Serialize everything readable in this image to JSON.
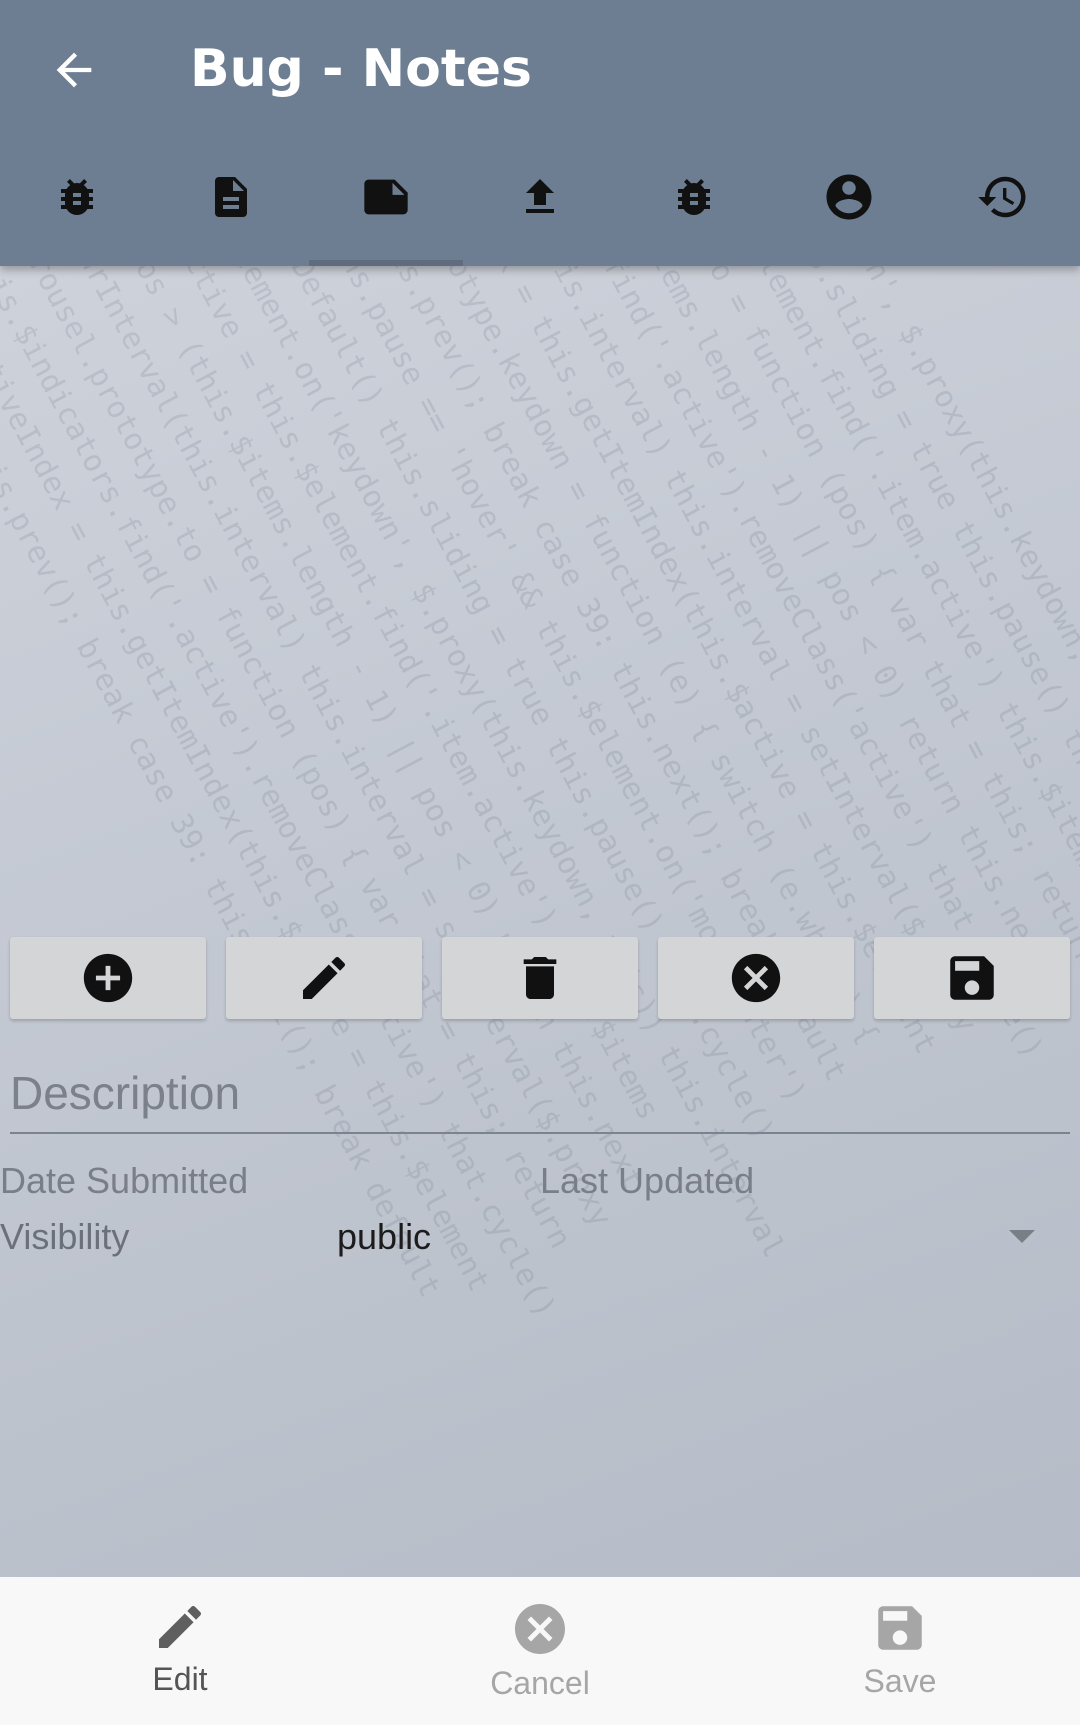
{
  "app_bar": {
    "title": "Bug - Notes",
    "back_icon": "arrow-back-icon"
  },
  "tabs": [
    {
      "icon": "bug-icon",
      "active": false
    },
    {
      "icon": "document-icon",
      "active": false
    },
    {
      "icon": "note-icon",
      "active": true
    },
    {
      "icon": "upload-icon",
      "active": false
    },
    {
      "icon": "bug-icon",
      "active": false
    },
    {
      "icon": "account-circle-icon",
      "active": false
    },
    {
      "icon": "history-icon",
      "active": false
    }
  ],
  "actions": [
    {
      "icon": "add-circle-icon"
    },
    {
      "icon": "pencil-icon"
    },
    {
      "icon": "trash-icon"
    },
    {
      "icon": "cancel-circle-icon"
    },
    {
      "icon": "save-icon"
    }
  ],
  "form": {
    "description_placeholder": "Description",
    "description_value": "",
    "date_submitted_label": "Date Submitted",
    "last_updated_label": "Last Updated",
    "visibility_label": "Visibility",
    "visibility_value": "public"
  },
  "bottom_bar": {
    "edit_label": "Edit",
    "cancel_label": "Cancel",
    "save_label": "Save"
  },
  "colors": {
    "app_bar": "#6d7e93",
    "action_button": "#d4d5d7",
    "bottom_bar": "#f8f8f8",
    "disabled": "#9e9e9e"
  }
}
